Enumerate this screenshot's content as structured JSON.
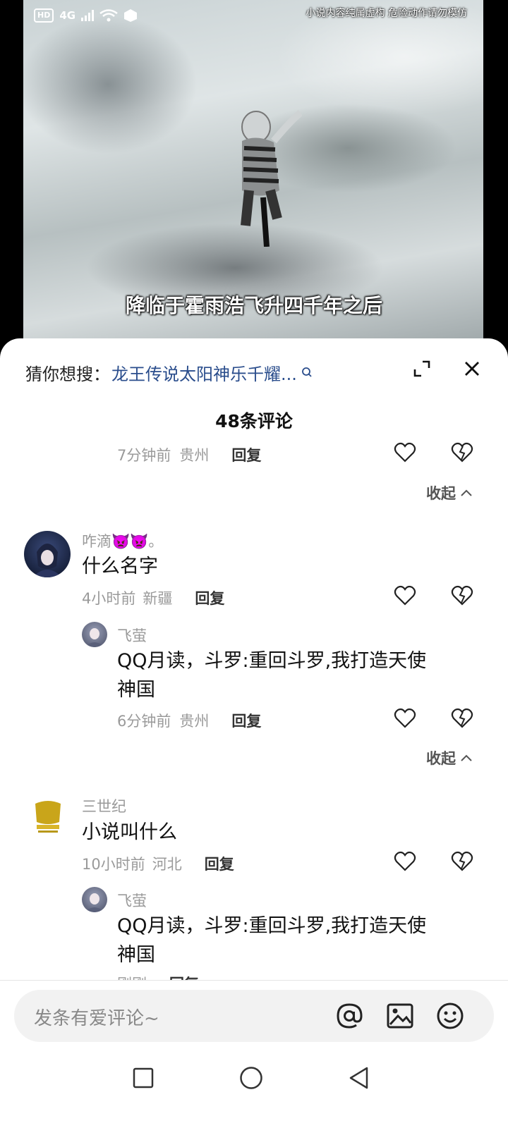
{
  "video": {
    "warning": "小说内容纯属虚构 危险动作请勿模仿",
    "subtitle": "降临于霍雨浩飞升四千年之后",
    "status": {
      "hd": "HD",
      "signal": "4G"
    }
  },
  "suggest": {
    "prefix": "猜你想搜：",
    "query": "龙王传说太阳神乐千耀..."
  },
  "comments_header": {
    "count_label": "48条评论"
  },
  "threads": [
    {
      "tail_meta": {
        "time": "7分钟前",
        "location": "贵州",
        "reply": "回复"
      },
      "collapse": "收起"
    },
    {
      "user": "咋滴👿👿。",
      "text": "什么名字",
      "meta": {
        "time": "4小时前",
        "location": "新疆",
        "reply": "回复"
      },
      "reply": {
        "user": "飞萤",
        "text_line1": "QQ月读，斗罗:重回斗罗,我打造天使",
        "text_line2": "神国",
        "meta": {
          "time": "6分钟前",
          "location": "贵州",
          "reply": "回复"
        }
      },
      "collapse": "收起"
    },
    {
      "user": "三世纪",
      "text": "小说叫什么",
      "meta": {
        "time": "10小时前",
        "location": "河北",
        "reply": "回复"
      },
      "reply": {
        "user": "飞萤",
        "text_line1": "QQ月读，斗罗:重回斗罗,我打造天使",
        "text_line2": "神国",
        "meta": {
          "time": "刚刚",
          "reply": "回复"
        }
      }
    }
  ],
  "input": {
    "placeholder": "发条有爱评论~"
  },
  "colors": {
    "link": "#2a4d8c",
    "muted": "#9a9a9a",
    "text": "#111111"
  }
}
